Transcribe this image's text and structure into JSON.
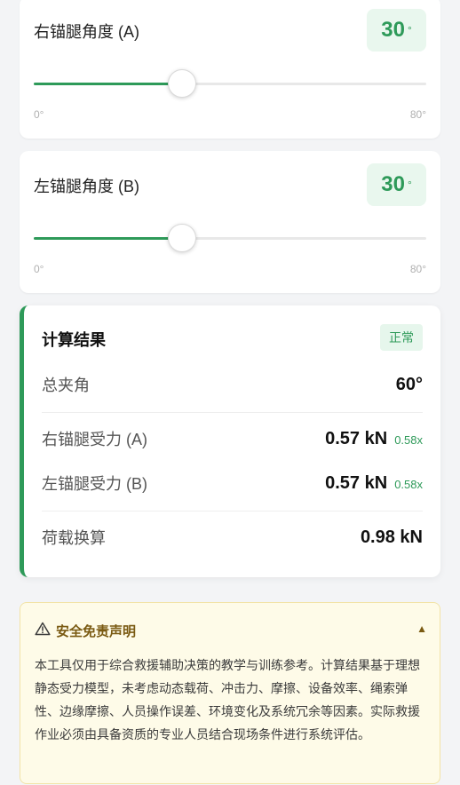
{
  "slider_a": {
    "title": "右锚腿角度 (A)",
    "value": "30",
    "unit": "°",
    "min_label": "0°",
    "max_label": "80°",
    "min": 0,
    "max": 80,
    "current": 30
  },
  "slider_b": {
    "title": "左锚腿角度 (B)",
    "value": "30",
    "unit": "°",
    "min_label": "0°",
    "max_label": "80°",
    "min": 0,
    "max": 80,
    "current": 30
  },
  "result": {
    "title": "计算结果",
    "status": "正常",
    "total_angle_label": "总夹角",
    "total_angle_value": "60°",
    "force_a_label": "右锚腿受力 (A)",
    "force_a_value": "0.57 kN",
    "force_a_ratio": "0.58x",
    "force_b_label": "左锚腿受力 (B)",
    "force_b_value": "0.57 kN",
    "force_b_ratio": "0.58x",
    "load_label": "荷载换算",
    "load_value": "0.98 kN"
  },
  "disclaimer": {
    "title": "安全免责声明",
    "toggle": "▲",
    "body": "本工具仅用于综合救援辅助决策的教学与训练参考。计算结果基于理想静态受力模型，未考虑动态载荷、冲击力、摩擦、设备效率、绳索弹性、边缘摩擦、人员操作误差、环境变化及系统冗余等因素。实际救援作业必须由具备资质的专业人员结合现场条件进行系统评估。"
  },
  "colors": {
    "accent": "#2e9a59",
    "warning_bg": "#fefbe8",
    "warning_text": "#7a5a12"
  }
}
